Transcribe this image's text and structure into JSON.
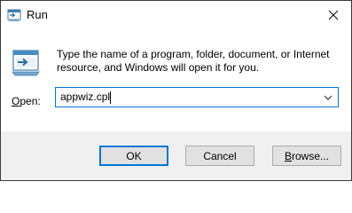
{
  "window": {
    "title": "Run",
    "title_icon": "run-icon",
    "close_icon": "close-icon"
  },
  "body": {
    "description": "Type the name of a program, folder, document, or Internet resource, and Windows will open it for you.",
    "big_icon": "run-dialog-icon",
    "open_label_mnemonic": "O",
    "open_label_rest": "pen:",
    "input_value": "appwiz.cpl",
    "dropdown_icon": "chevron-down-icon"
  },
  "buttons": {
    "ok": "OK",
    "cancel": "Cancel",
    "browse_mnemonic": "B",
    "browse_rest": "rowse..."
  },
  "colors": {
    "accent": "#0078d7",
    "footer_bg": "#f0f0f0",
    "button_bg": "#e1e1e1"
  }
}
